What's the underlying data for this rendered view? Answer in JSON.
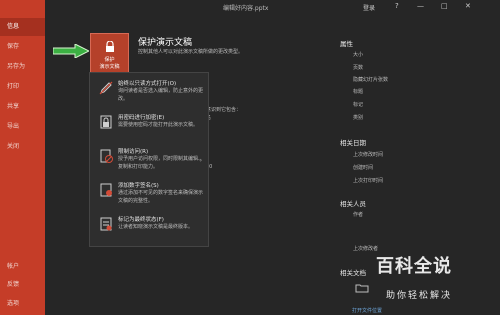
{
  "window": {
    "title": "编辑好内容.pptx",
    "signin": "登录",
    "buttons": [
      "?",
      "—",
      "□",
      "✕"
    ]
  },
  "sidebar": {
    "items": [
      {
        "label": "信息",
        "active": true
      },
      {
        "label": "保存"
      },
      {
        "label": "另存为"
      },
      {
        "label": "打印"
      },
      {
        "label": "共享"
      },
      {
        "label": "导出"
      },
      {
        "label": "关闭"
      }
    ],
    "bottom": [
      {
        "label": "帐户"
      },
      {
        "label": "反馈"
      },
      {
        "label": "选项"
      }
    ]
  },
  "protect": {
    "button_line1": "保护",
    "button_line2": "演示文稿",
    "title": "保护演示文稿",
    "desc": "控制其他人可以对此演示文稿所做的更改类型。",
    "fragments": [
      "意识到它包含：",
      "名",
      "20"
    ]
  },
  "menu": {
    "items": [
      {
        "title": "始终以只读方式打开(O)",
        "desc": "询问读者是否选入编辑，防止意外的更改。",
        "icon": "pencil-icon"
      },
      {
        "title": "用密码进行加密(E)",
        "desc": "需要使用密码才能打开此演示文稿。",
        "icon": "lock-key-icon"
      },
      {
        "title": "限制访问(R)",
        "desc": "授予用户访问权限，同时限制其编辑、复制和打印能力。",
        "icon": "restrict-access-icon",
        "has_submenu": true
      },
      {
        "title": "添加数字签名(S)",
        "desc": "通过添加不可见的数字签名来确保演示文稿的完整性。",
        "icon": "signature-icon"
      },
      {
        "title": "标记为最终状态(F)",
        "desc": "让读者知晓演示文稿是最终版本。",
        "icon": "final-document-icon"
      }
    ]
  },
  "properties": {
    "heading": "属性",
    "items": [
      "大小",
      "页数",
      "隐藏幻灯片张数",
      "标题",
      "标记",
      "类别"
    ],
    "dates_heading": "相关日期",
    "dates": [
      "上次修改时间",
      "创建时间",
      "上次打印时间"
    ],
    "people_heading": "相关人员",
    "people": [
      "作者",
      "上次修改者"
    ],
    "docs_heading": "相关文档",
    "open_location": "打开文件位置"
  },
  "watermark": {
    "main": "百科全说",
    "sub": "助你轻松解决"
  },
  "colors": {
    "sidebar": "#c53d28",
    "background": "#262626",
    "menu": "#2e2e2e",
    "arrow": "#3cb043"
  }
}
